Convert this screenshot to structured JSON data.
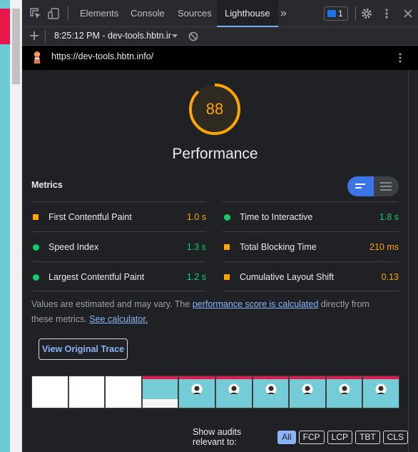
{
  "tabs": {
    "elements": "Elements",
    "console": "Console",
    "sources": "Sources",
    "lighthouse": "Lighthouse",
    "more": "»"
  },
  "issues_count": "1",
  "report_selector": "8:25:12 PM - dev-tools.hbtn.ir",
  "url": "https://dev-tools.hbtn.info/",
  "score": "88",
  "category": "Performance",
  "metrics_title": "Metrics",
  "metrics": {
    "fcp": {
      "label": "First Contentful Paint",
      "value": "1.0 s",
      "status": "average",
      "color": "#ffa400"
    },
    "tti": {
      "label": "Time to Interactive",
      "value": "1.8 s",
      "status": "pass",
      "color": "#0cce6b"
    },
    "si": {
      "label": "Speed Index",
      "value": "1.3 s",
      "status": "pass",
      "color": "#0cce6b"
    },
    "tbt": {
      "label": "Total Blocking Time",
      "value": "210 ms",
      "status": "average",
      "color": "#ffa400"
    },
    "lcp": {
      "label": "Largest Contentful Paint",
      "value": "1.2 s",
      "status": "pass",
      "color": "#0cce6b"
    },
    "cls": {
      "label": "Cumulative Layout Shift",
      "value": "0.13",
      "status": "average",
      "color": "#ffa400"
    }
  },
  "note": {
    "prefix": "Values are estimated and may vary. The ",
    "link1": "performance score is calculated",
    "middle": " directly from these metrics. ",
    "link2": "See calculator."
  },
  "view_trace": "View Original Trace",
  "audits_label": "Show audits relevant to:",
  "filters": [
    "All",
    "FCP",
    "LCP",
    "TBT",
    "CLS"
  ],
  "colors": {
    "accent": "#8ab4f8",
    "average": "#ffa400",
    "pass": "#0cce6b"
  }
}
